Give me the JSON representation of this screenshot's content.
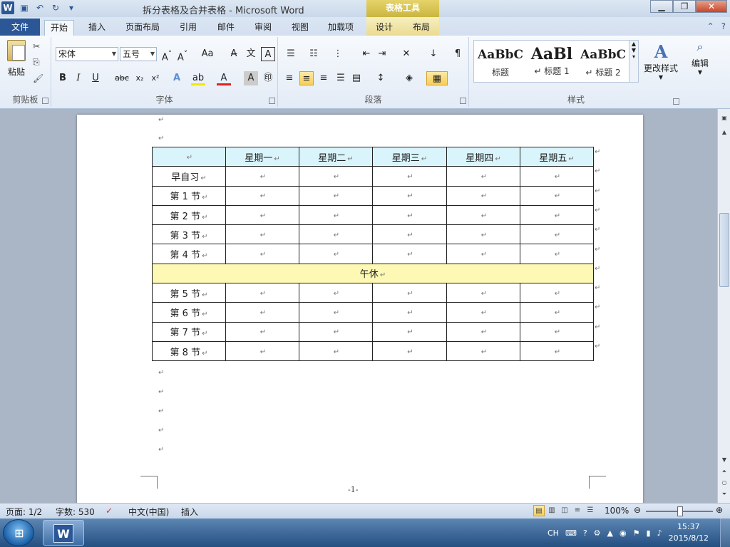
{
  "window": {
    "title": "拆分表格及合并表格 - Microsoft Word",
    "context_group": "表格工具",
    "controls": {
      "minimize": "▁",
      "restore": "❐",
      "close": "✕"
    }
  },
  "tabs": {
    "file": "文件",
    "items": [
      "开始",
      "插入",
      "页面布局",
      "引用",
      "邮件",
      "审阅",
      "视图",
      "加载项",
      "设计",
      "布局"
    ]
  },
  "ribbon": {
    "clipboard": {
      "label": "剪贴板",
      "paste": "粘贴"
    },
    "font": {
      "label": "字体",
      "font_name": "宋体",
      "font_size": "五号"
    },
    "paragraph": {
      "label": "段落"
    },
    "styles": {
      "label": "样式",
      "items": [
        {
          "sample": "AaBbC",
          "name": "标题"
        },
        {
          "sample": "AaBl",
          "name": "↵ 标题 1"
        },
        {
          "sample": "AaBbC",
          "name": "↵ 标题 2"
        }
      ],
      "change_styles": "更改样式"
    },
    "editing": {
      "label": "编辑"
    }
  },
  "document": {
    "table": {
      "header": [
        "",
        "星期一",
        "星期二",
        "星期三",
        "星期四",
        "星期五"
      ],
      "morning_rows": [
        "早自习",
        "第 1 节",
        "第 2 节",
        "第 3 节",
        "第 4 节"
      ],
      "lunch": "午休",
      "afternoon_rows": [
        "第 5 节",
        "第 6 节",
        "第 7 节",
        "第 8 节"
      ]
    },
    "paragraph_mark": "↵",
    "page_number": "-1-"
  },
  "statusbar": {
    "page": "页面: 1/2",
    "words": "字数: 530",
    "language": "中文(中国)",
    "mode": "插入",
    "zoom": "100%"
  },
  "taskbar": {
    "lang": "CH",
    "time": "15:37",
    "date": "2015/8/12"
  }
}
